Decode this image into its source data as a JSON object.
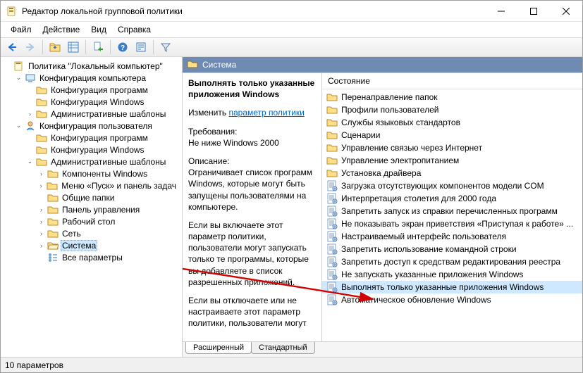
{
  "window": {
    "title": "Редактор локальной групповой политики"
  },
  "menu": {
    "file": "Файл",
    "action": "Действие",
    "view": "Вид",
    "help": "Справка"
  },
  "tree": {
    "root": "Политика \"Локальный компьютер\"",
    "comp": "Конфигурация компьютера",
    "comp_prog": "Конфигурация программ",
    "comp_win": "Конфигурация Windows",
    "comp_adm": "Административные шаблоны",
    "user": "Конфигурация пользователя",
    "user_prog": "Конфигурация программ",
    "user_win": "Конфигурация Windows",
    "user_adm": "Административные шаблоны",
    "adm_winc": "Компоненты Windows",
    "adm_start": "Меню «Пуск» и панель задач",
    "adm_shared": "Общие папки",
    "adm_cp": "Панель управления",
    "adm_desktop": "Рабочий стол",
    "adm_net": "Сеть",
    "adm_sys": "Система",
    "adm_all": "Все параметры"
  },
  "detail": {
    "header": "Система",
    "policy_name": "Выполнять только указанные приложения Windows",
    "edit_prefix": "Изменить ",
    "edit_link": "параметр политики",
    "req_label": "Требования:",
    "req_value": "Не ниже Windows 2000",
    "desc_label": "Описание:",
    "desc_p1": "Ограничивает список программ Windows, которые могут быть запущены пользователями на компьютере.",
    "desc_p2": "Если вы включаете этот параметр политики, пользователи могут запускать только те программы, которые вы добавляете в список разрешенных приложений.",
    "desc_p3": "Если вы отключаете или не настраиваете этот параметр политики, пользователи могут",
    "state_header": "Состояние",
    "items": [
      {
        "type": "folder",
        "label": "Перенаправление папок"
      },
      {
        "type": "folder",
        "label": "Профили пользователей"
      },
      {
        "type": "folder",
        "label": "Службы языковых стандартов"
      },
      {
        "type": "folder",
        "label": "Сценарии"
      },
      {
        "type": "folder",
        "label": "Управление связью через Интернет"
      },
      {
        "type": "folder",
        "label": "Управление электропитанием"
      },
      {
        "type": "folder",
        "label": "Установка драйвера"
      },
      {
        "type": "setting",
        "label": "Загрузка отсутствующих компонентов модели COM"
      },
      {
        "type": "setting",
        "label": "Интерпретация столетия для 2000 года"
      },
      {
        "type": "setting",
        "label": "Запретить запуск из справки перечисленных программ"
      },
      {
        "type": "setting",
        "label": "Не показывать экран приветствия «Приступая к работе» ..."
      },
      {
        "type": "setting",
        "label": "Настраиваемый интерфейс пользователя"
      },
      {
        "type": "setting",
        "label": "Запретить использование командной строки"
      },
      {
        "type": "setting",
        "label": "Запретить доступ к средствам редактирования реестра"
      },
      {
        "type": "setting",
        "label": "Не запускать указанные приложения Windows"
      },
      {
        "type": "setting",
        "label": "Выполнять только указанные приложения Windows",
        "selected": true
      },
      {
        "type": "setting",
        "label": "Автоматическое обновление Windows"
      }
    ],
    "tabs": {
      "extended": "Расширенный",
      "standard": "Стандартный"
    }
  },
  "status": {
    "count": "10 параметров"
  }
}
